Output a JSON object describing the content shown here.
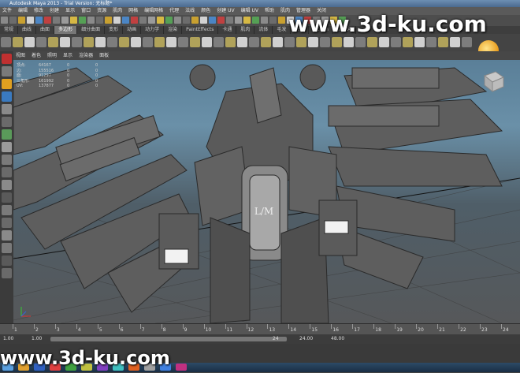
{
  "window": {
    "title": "Autodesk Maya 2013 - Trial Version: 无标题*"
  },
  "menubar": {
    "items": [
      "文件",
      "编辑",
      "修改",
      "创建",
      "显示",
      "窗口",
      "资源",
      "肌肉",
      "网格",
      "编辑网格",
      "代理",
      "法线",
      "颜色",
      "创建 UV",
      "编辑 UV",
      "帮助",
      "肌肉",
      "管理器",
      "关闭"
    ]
  },
  "shelf": {
    "tabs": [
      "常规",
      "曲线",
      "曲面",
      "多边形",
      "细分曲面",
      "变形",
      "动画",
      "动力学",
      "渲染",
      "PaintEffects",
      "卡通",
      "肌肉",
      "流体",
      "毛发",
      "头发",
      "nCloth",
      "自定义"
    ],
    "active_index": 3
  },
  "panel_menu": {
    "items": [
      "视图",
      "着色",
      "照明",
      "显示",
      "渲染器",
      "面板"
    ]
  },
  "hud": {
    "rows": [
      {
        "label": "顶点:",
        "value": "64167",
        "c3": "0",
        "c4": "0"
      },
      {
        "label": "边:",
        "value": "155516",
        "c3": "0",
        "c4": "0"
      },
      {
        "label": "面:",
        "value": "91297",
        "c3": "0",
        "c4": "0"
      },
      {
        "label": "三角形:",
        "value": "161992",
        "c3": "0",
        "c4": "0"
      },
      {
        "label": "UV:",
        "value": "137877",
        "c3": "0",
        "c4": "0"
      }
    ]
  },
  "model": {
    "emblem": "L/M"
  },
  "timeline": {
    "ticks": [
      "1",
      "2",
      "3",
      "4",
      "5",
      "6",
      "7",
      "8",
      "9",
      "10",
      "11",
      "12",
      "13",
      "14",
      "15",
      "16",
      "17",
      "18",
      "19",
      "20",
      "21",
      "22",
      "23",
      "24"
    ]
  },
  "range": {
    "start": "1.00",
    "start_inner": "1.00",
    "end_inner": "24",
    "end": "24.00",
    "end_total": "48.00"
  },
  "watermark": {
    "top": "www.3d-ku.com",
    "bottom": "www.3d-ku.com"
  },
  "colors": {
    "title": "#4a6a8f",
    "accent": "#e89a1a",
    "viewport_top": "#5a7f98"
  }
}
